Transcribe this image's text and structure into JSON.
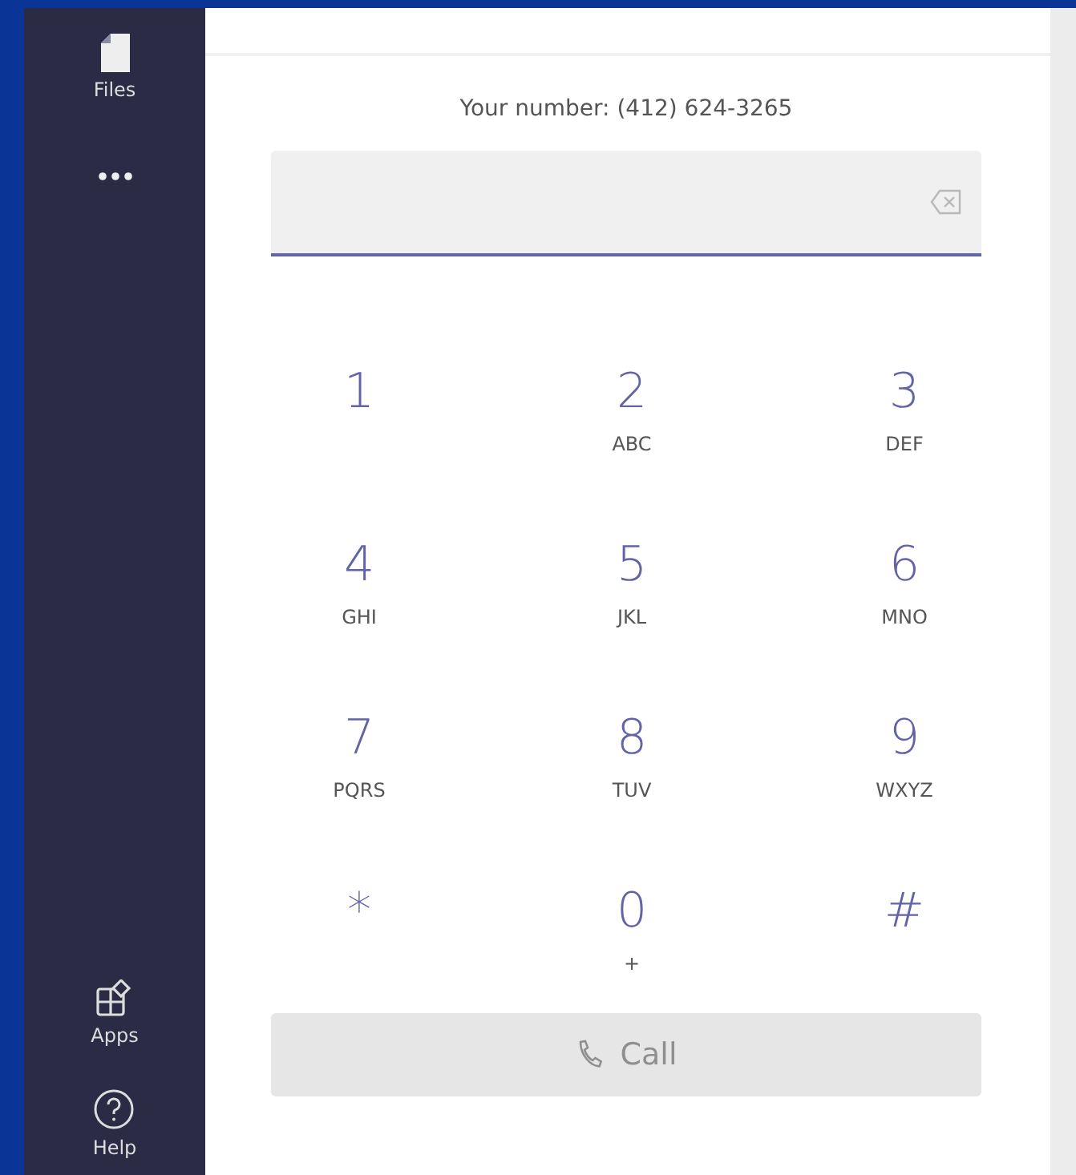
{
  "sidebar": {
    "top_items": [
      {
        "kind": "files",
        "label": "Files"
      },
      {
        "kind": "more"
      }
    ],
    "bottom_items": [
      {
        "kind": "apps",
        "label": "Apps"
      },
      {
        "kind": "help",
        "label": "Help"
      }
    ]
  },
  "your_number": "Your number: (412) 624-3265",
  "dial_field": {
    "focused": true
  },
  "keys": [
    {
      "digit": "1"
    },
    {
      "digit": "2",
      "letters": "ABC"
    },
    {
      "digit": "3",
      "letters": "DEF"
    },
    {
      "digit": "4",
      "letters": "GHI"
    },
    {
      "digit": "5",
      "letters": "JKL"
    },
    {
      "digit": "6",
      "letters": "MNO"
    },
    {
      "digit": "7",
      "letters": "PQRS"
    },
    {
      "digit": "8",
      "letters": "TUV"
    },
    {
      "digit": "9",
      "letters": "WXYZ"
    },
    {
      "digit": "*"
    },
    {
      "digit": "0",
      "letters": "+"
    },
    {
      "digit": "#"
    }
  ],
  "call_button": {
    "label": "Call",
    "disabled": true
  }
}
